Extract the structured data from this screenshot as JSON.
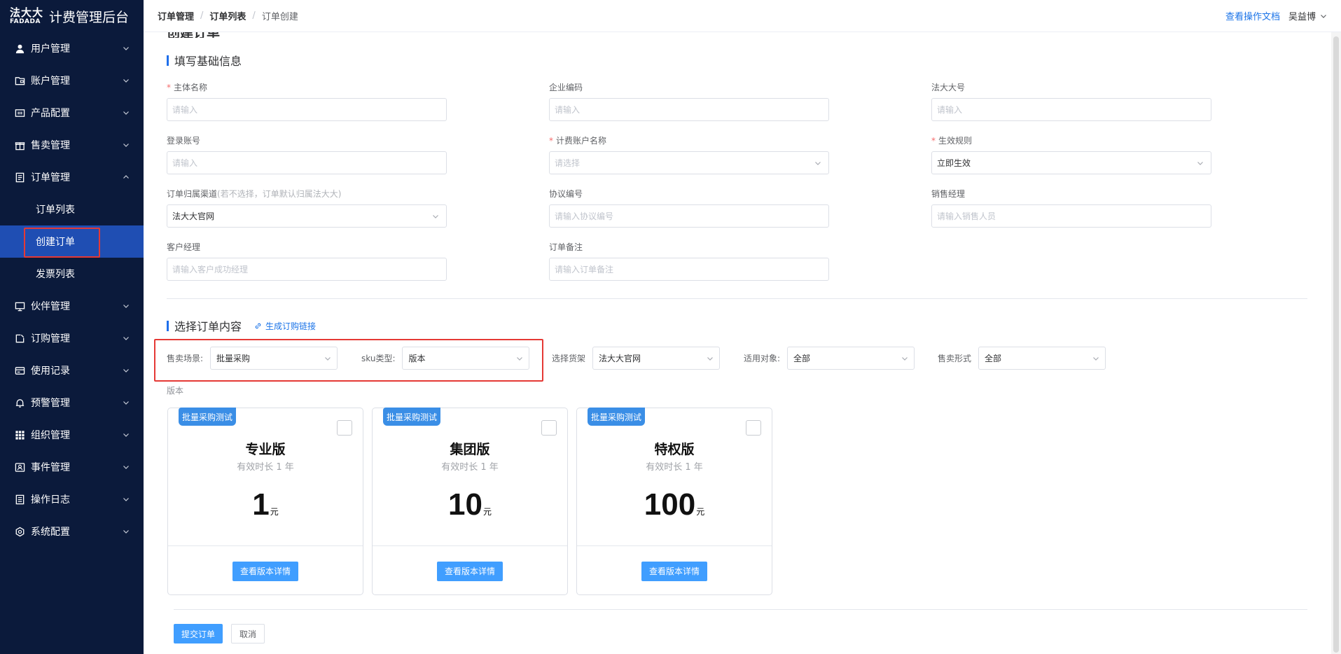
{
  "app": {
    "logo_cn": "法大大",
    "logo_en": "FADADA",
    "title": "计费管理后台"
  },
  "sidebar": {
    "items": [
      {
        "label": "用户管理",
        "icon": "user-icon"
      },
      {
        "label": "账户管理",
        "icon": "folder-icon"
      },
      {
        "label": "产品配置",
        "icon": "config-icon"
      },
      {
        "label": "售卖管理",
        "icon": "gift-icon"
      },
      {
        "label": "订单管理",
        "icon": "document-icon",
        "expanded": true
      },
      {
        "label": "伙伴管理",
        "icon": "monitor-icon"
      },
      {
        "label": "订购管理",
        "icon": "edit-icon"
      },
      {
        "label": "使用记录",
        "icon": "card-icon"
      },
      {
        "label": "预警管理",
        "icon": "bell-icon"
      },
      {
        "label": "组织管理",
        "icon": "grid-icon"
      },
      {
        "label": "事件管理",
        "icon": "event-icon"
      },
      {
        "label": "操作日志",
        "icon": "log-icon"
      },
      {
        "label": "系统配置",
        "icon": "settings-icon"
      }
    ],
    "order_submenu": [
      {
        "label": "订单列表",
        "active": false
      },
      {
        "label": "创建订单",
        "active": true
      },
      {
        "label": "发票列表",
        "active": false
      }
    ]
  },
  "header": {
    "breadcrumb": [
      "订单管理",
      "订单列表",
      "订单创建"
    ],
    "doc_link": "查看操作文档",
    "user": "吴益博"
  },
  "page": {
    "title": "创建订单"
  },
  "basic_info": {
    "section_title": "填写基础信息",
    "fields": {
      "subject_name": {
        "label": "主体名称",
        "required": true,
        "placeholder": "请输入"
      },
      "company_code": {
        "label": "企业编码",
        "required": false,
        "placeholder": "请输入"
      },
      "fadada_id": {
        "label": "法大大号",
        "required": false,
        "placeholder": "请输入"
      },
      "login_account": {
        "label": "登录账号",
        "required": false,
        "placeholder": "请输入"
      },
      "billing_account": {
        "label": "计费账户名称",
        "required": true,
        "placeholder": "请选择"
      },
      "effective_rule": {
        "label": "生效规则",
        "required": true,
        "value": "立即生效"
      },
      "order_channel": {
        "label": "订单归属渠道",
        "hint": "(若不选择，订单默认归属法大大)",
        "value": "法大大官网"
      },
      "agreement_no": {
        "label": "协议编号",
        "placeholder": "请输入协议编号"
      },
      "sales_manager": {
        "label": "销售经理",
        "placeholder": "请输入销售人员"
      },
      "customer_manager": {
        "label": "客户经理",
        "placeholder": "请输入客户成功经理"
      },
      "order_remark": {
        "label": "订单备注",
        "placeholder": "请输入订单备注"
      }
    }
  },
  "order_content": {
    "section_title": "选择订单内容",
    "gen_link": "生成订购链接",
    "filters": {
      "scene": {
        "label": "售卖场景:",
        "value": "批量采购"
      },
      "sku_type": {
        "label": "sku类型:",
        "value": "版本"
      },
      "shelf": {
        "label": "选择货架",
        "value": "法大大官网"
      },
      "target": {
        "label": "适用对象:",
        "value": "全部"
      },
      "sale_form": {
        "label": "售卖形式",
        "value": "全部"
      }
    },
    "version_label": "版本",
    "cards": [
      {
        "tag": "批量采购测试",
        "name": "专业版",
        "duration": "有效时长 1 年",
        "price": "1",
        "unit": "元",
        "button": "查看版本详情"
      },
      {
        "tag": "批量采购测试",
        "name": "集团版",
        "duration": "有效时长 1 年",
        "price": "10",
        "unit": "元",
        "button": "查看版本详情"
      },
      {
        "tag": "批量采购测试",
        "name": "特权版",
        "duration": "有效时长 1 年",
        "price": "100",
        "unit": "元",
        "button": "查看版本详情"
      }
    ]
  },
  "actions": {
    "submit": "提交订单",
    "cancel": "取消"
  },
  "colors": {
    "sidebar_bg": "#0b1a3b",
    "active_menu": "#1f4eb3",
    "primary": "#409eff",
    "highlight_border": "#e53935"
  }
}
